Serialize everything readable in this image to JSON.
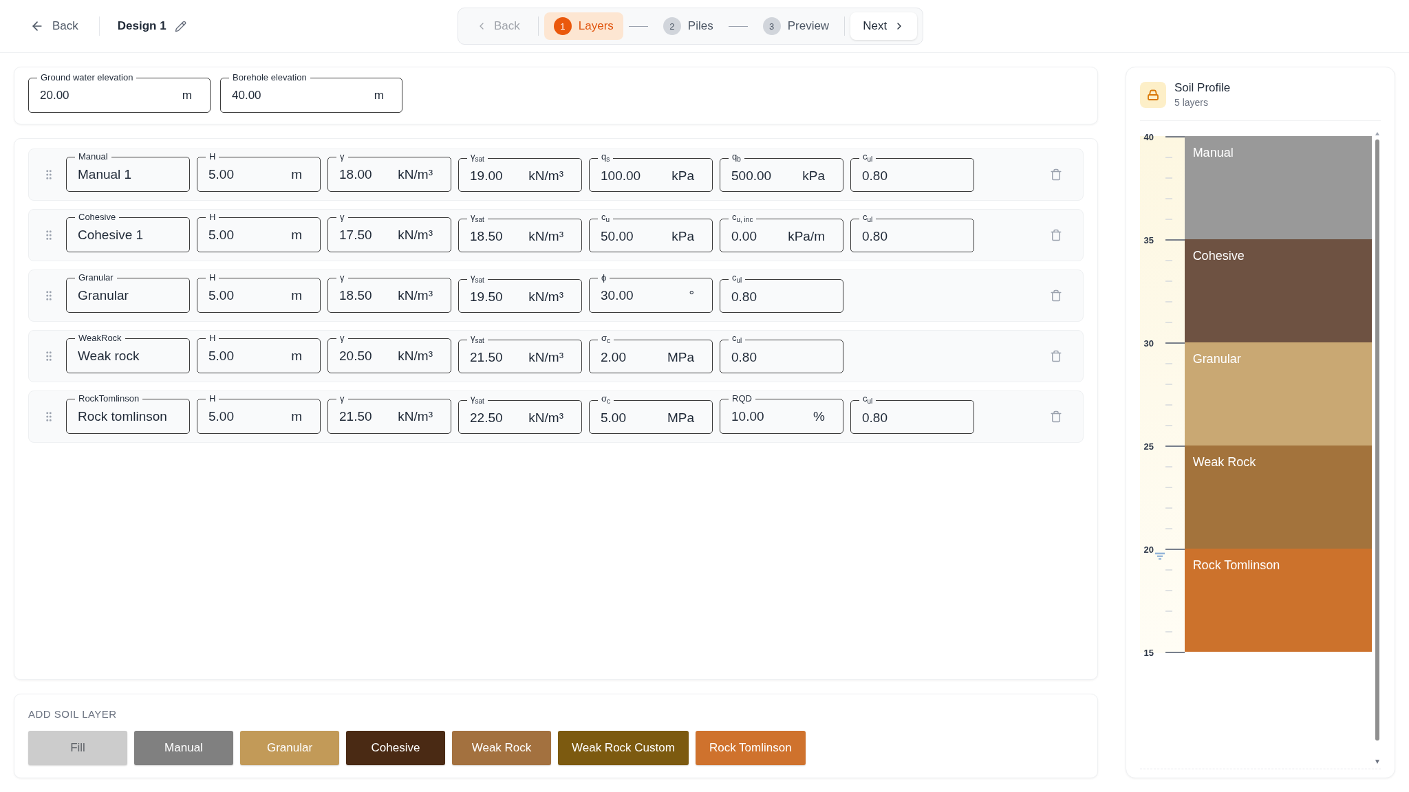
{
  "top_bar": {
    "back": "Back",
    "title": "Design 1"
  },
  "stepper": {
    "back": {
      "label": "Back",
      "disabled": true
    },
    "steps": [
      {
        "number": "1",
        "label": "Layers",
        "selected": true
      },
      {
        "number": "2",
        "label": "Piles",
        "selected": false
      },
      {
        "number": "3",
        "label": "Preview",
        "selected": false
      }
    ],
    "next": {
      "label": "Next"
    }
  },
  "elevations": [
    {
      "label": "Ground water elevation",
      "value": "20.00",
      "unit": "m"
    },
    {
      "label": "Borehole elevation",
      "value": "40.00",
      "unit": "m"
    }
  ],
  "layers": [
    {
      "type": "Manual",
      "name": "Manual 1",
      "fields": [
        {
          "label": "H",
          "value": "5.00",
          "unit": "m"
        },
        {
          "label": "γ",
          "value": "18.00",
          "unit": "kN/m³"
        },
        {
          "label": "γ$_{sat}$",
          "value": "19.00",
          "unit": "kN/m³"
        },
        {
          "label": "q$_{s}$",
          "value": "100.00",
          "unit": "kPa"
        },
        {
          "label": "q$_{b}$",
          "value": "500.00",
          "unit": "kPa"
        },
        {
          "label": "c$_{ul}$",
          "value": "0.80"
        }
      ]
    },
    {
      "type": "Cohesive",
      "name": "Cohesive 1",
      "fields": [
        {
          "label": "H",
          "value": "5.00",
          "unit": "m"
        },
        {
          "label": "γ",
          "value": "17.50",
          "unit": "kN/m³"
        },
        {
          "label": "γ$_{sat}$",
          "value": "18.50",
          "unit": "kN/m³"
        },
        {
          "label": "c$_{u}$",
          "value": "50.00",
          "unit": "kPa"
        },
        {
          "label": "c$_{u, inc}$",
          "value": "0.00",
          "unit": "kPa/m"
        },
        {
          "label": "c$_{ul}$",
          "value": "0.80"
        }
      ]
    },
    {
      "type": "Granular",
      "name": "Granular",
      "fields": [
        {
          "label": "H",
          "value": "5.00",
          "unit": "m"
        },
        {
          "label": "γ",
          "value": "18.50",
          "unit": "kN/m³"
        },
        {
          "label": "γ$_{sat}$",
          "value": "19.50",
          "unit": "kN/m³"
        },
        {
          "label": "ϕ",
          "value": "30.00",
          "unit": "°"
        },
        {
          "label": "c$_{ul}$",
          "value": "0.80"
        }
      ]
    },
    {
      "type": "WeakRock",
      "name": "Weak rock",
      "fields": [
        {
          "label": "H",
          "value": "5.00",
          "unit": "m"
        },
        {
          "label": "γ",
          "value": "20.50",
          "unit": "kN/m³"
        },
        {
          "label": "γ$_{sat}$",
          "value": "21.50",
          "unit": "kN/m³"
        },
        {
          "label": "σ$_{c}$",
          "value": "2.00",
          "unit": "MPa"
        },
        {
          "label": "c$_{ul}$",
          "value": "0.80"
        }
      ]
    },
    {
      "type": "RockTomlinson",
      "name": "Rock tomlinson",
      "fields": [
        {
          "label": "H",
          "value": "5.00",
          "unit": "m"
        },
        {
          "label": "γ",
          "value": "21.50",
          "unit": "kN/m³"
        },
        {
          "label": "γ$_{sat}$",
          "value": "22.50",
          "unit": "kN/m³"
        },
        {
          "label": "σ$_{c}$",
          "value": "5.00",
          "unit": "MPa"
        },
        {
          "label": "RQD",
          "value": "10.00",
          "unit": "%"
        },
        {
          "label": "c$_{ul}$",
          "value": "0.80"
        }
      ]
    }
  ],
  "add_soil_layer": {
    "title": "ADD SOIL LAYER",
    "buttons": [
      {
        "label": "Fill",
        "color": "#cccccc"
      },
      {
        "label": "Manual",
        "color": "#808080"
      },
      {
        "label": "Granular",
        "color": "#c29a58"
      },
      {
        "label": "Cohesive",
        "color": "#4a2a14"
      },
      {
        "label": "Weak Rock",
        "color": "#a3713f"
      },
      {
        "label": "Weak Rock Custom",
        "color": "#7c5a10"
      },
      {
        "label": "Rock Tomlinson",
        "color": "#cf722d"
      }
    ]
  },
  "soil_profile": {
    "title": "Soil Profile",
    "subtitle": "5 layers",
    "ticks": [
      "40",
      "35",
      "30",
      "25",
      "20",
      "15"
    ],
    "layers": [
      {
        "label": "Manual",
        "color": "#999999"
      },
      {
        "label": "Cohesive",
        "color": "#6e5242"
      },
      {
        "label": "Granular",
        "color": "#c9a873"
      },
      {
        "label": "Weak Rock",
        "color": "#a3733c"
      },
      {
        "label": "Rock Tomlinson",
        "color": "#cc722c"
      }
    ]
  }
}
